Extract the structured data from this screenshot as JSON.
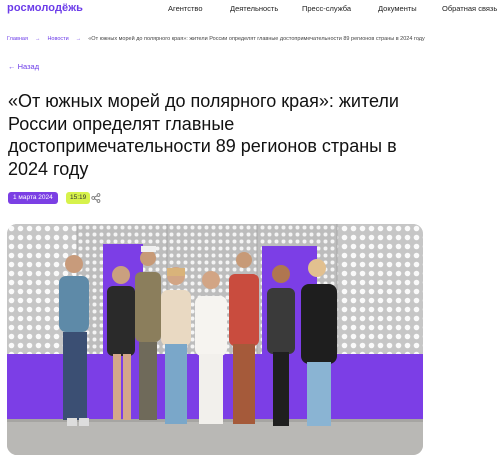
{
  "header": {
    "logo": "росмолодёжь",
    "nav": [
      "Агентство",
      "Деятельность",
      "Пресс-служба",
      "Документы",
      "Обратная связь"
    ]
  },
  "breadcrumbs": {
    "home": "Главная",
    "news": "Новости",
    "current": "«От южных морей до полярного края»: жители России определят главные достопримечательности 89 регионов страны в 2024 году",
    "separator": "→"
  },
  "back_label": "← Назад",
  "article": {
    "title": "«От южных морей до полярного края»: жители России определят главные достопримечательности 89 регионов страны в 2024 году",
    "date": "1 марта 2024",
    "time": "15:19"
  },
  "icons": {
    "share": "share-icon"
  },
  "colors": {
    "accent": "#7b3fe4",
    "time_badge": "#d7f24b"
  }
}
